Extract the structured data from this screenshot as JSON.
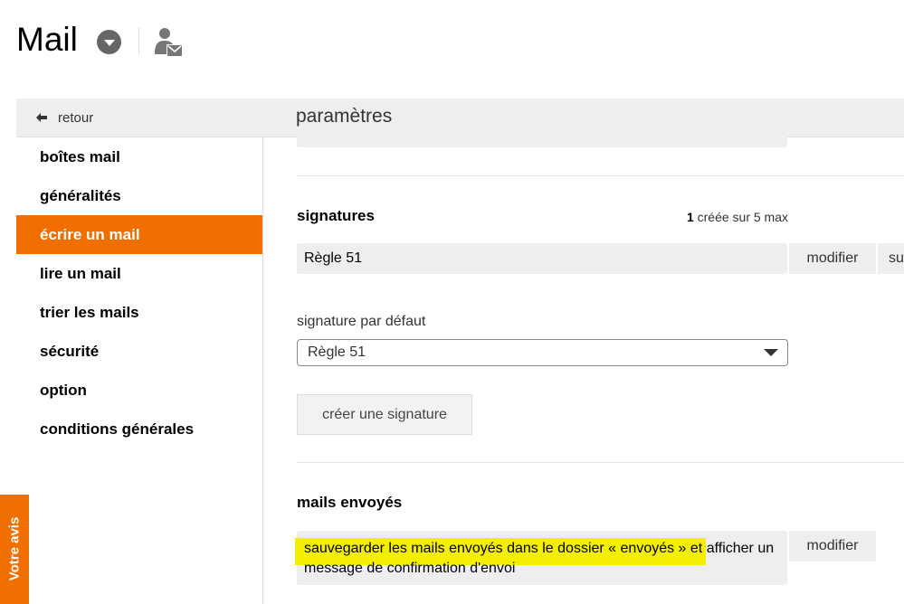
{
  "header": {
    "app_title": "Mail"
  },
  "topbar": {
    "back_label": "retour",
    "page_title": "paramètres"
  },
  "sidebar": {
    "items": [
      {
        "label": "boîtes mail"
      },
      {
        "label": "généralités"
      },
      {
        "label": "écrire un mail",
        "active": true
      },
      {
        "label": "lire un mail"
      },
      {
        "label": "trier les mails"
      },
      {
        "label": "sécurité"
      },
      {
        "label": "option"
      },
      {
        "label": "conditions générales"
      }
    ]
  },
  "signatures": {
    "title": "signatures",
    "count": "1",
    "count_suffix": " créée sur 5 max",
    "items": [
      {
        "name": "Règle 51",
        "modify_label": "modifier",
        "delete_label": "supprimer"
      }
    ],
    "default_label": "signature par défaut",
    "default_value": "Règle 51",
    "create_label": "créer une signature"
  },
  "sent": {
    "title": "mails envoyés",
    "text": "sauvegarder les mails envoyés dans le dossier « envoyés » et afficher un message de confirmation d'envoi",
    "modify_label": "modifier"
  },
  "feedback": {
    "label": "Votre avis"
  },
  "colors": {
    "accent": "#f16e00",
    "highlight": "#f4ef00",
    "panel_gray": "#eeeeee"
  },
  "icons": [
    "chevron-down-icon",
    "contact-mail-icon",
    "arrow-left-icon",
    "dropdown-arrow-icon"
  ]
}
